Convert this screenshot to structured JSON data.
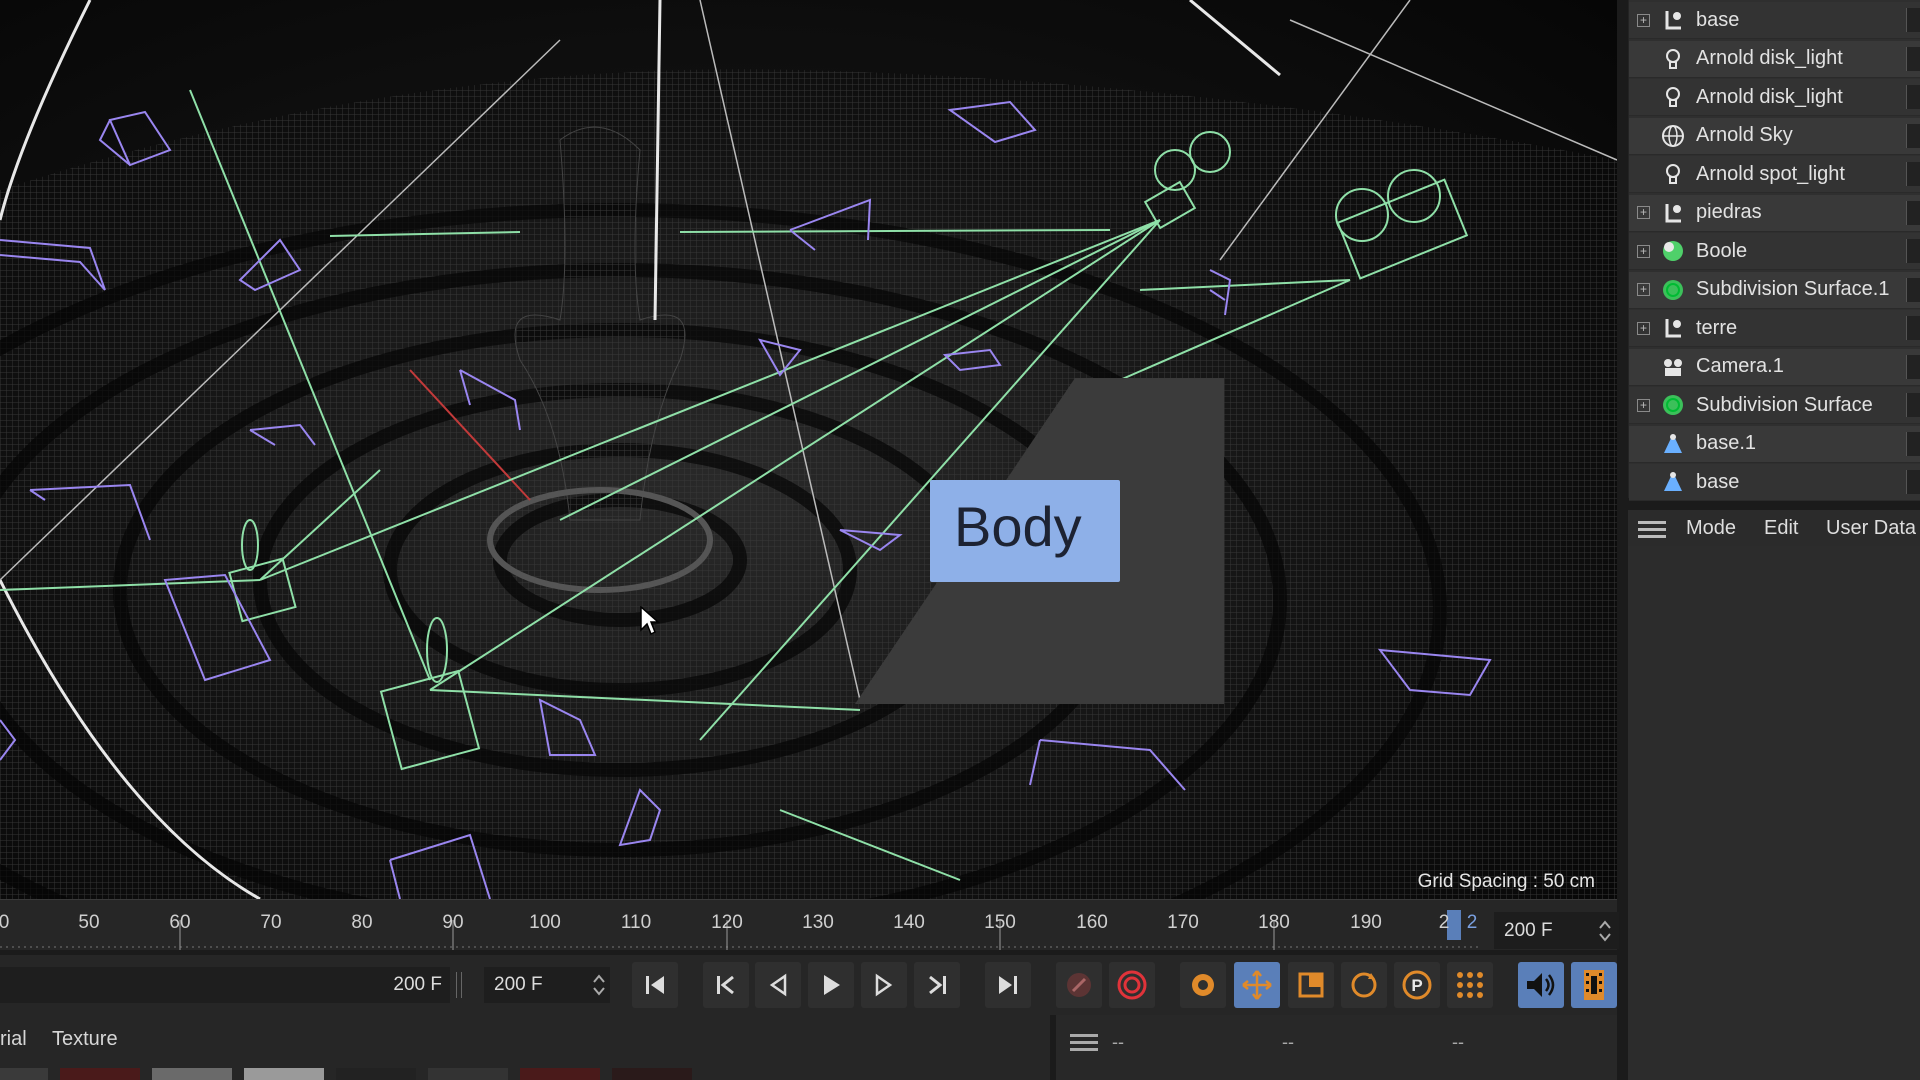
{
  "viewport": {
    "grid_spacing": "Grid Spacing : 50 cm",
    "tooltip_text": "Body"
  },
  "object_manager": {
    "items": [
      {
        "label": "base",
        "icon": "null-object-icon",
        "expandable": true
      },
      {
        "label": "Arnold disk_light",
        "icon": "light-bulb-icon",
        "expandable": false
      },
      {
        "label": "Arnold disk_light",
        "icon": "light-bulb-icon",
        "expandable": false
      },
      {
        "label": "Arnold Sky",
        "icon": "sky-globe-icon",
        "expandable": false
      },
      {
        "label": "Arnold spot_light",
        "icon": "light-bulb-icon",
        "expandable": false
      },
      {
        "label": "piedras",
        "icon": "null-object-icon",
        "expandable": true
      },
      {
        "label": "Boole",
        "icon": "boole-icon",
        "expandable": true
      },
      {
        "label": "Subdivision Surface.1",
        "icon": "subdivision-surface-icon",
        "expandable": true
      },
      {
        "label": "terre",
        "icon": "null-object-icon",
        "expandable": true
      },
      {
        "label": "Camera.1",
        "icon": "camera-icon",
        "expandable": false
      },
      {
        "label": "Subdivision Surface",
        "icon": "subdivision-surface-icon",
        "expandable": true
      },
      {
        "label": "base.1",
        "icon": "polygon-object-icon",
        "expandable": false
      },
      {
        "label": "base",
        "icon": "polygon-object-icon",
        "expandable": false
      }
    ]
  },
  "attributes": {
    "menu": [
      "Mode",
      "Edit",
      "User Data"
    ]
  },
  "timeline": {
    "ticks": [
      "0",
      "50",
      "60",
      "70",
      "80",
      "90",
      "100",
      "110",
      "120",
      "130",
      "140",
      "150",
      "160",
      "170",
      "180",
      "190",
      "2",
      "2"
    ],
    "end_frame": "200 F"
  },
  "transport": {
    "max_frame": "200 F",
    "preview_end": "200 F"
  },
  "bottom": {
    "tabs": [
      "rial",
      "Texture"
    ],
    "coords": [
      "--",
      "--",
      "--"
    ]
  },
  "colors": {
    "accent_blue": "#5a7fb9",
    "camera_green": "#8fe0a8",
    "wire_purple": "#9a86f0",
    "record_red": "#e0333a",
    "key_orange": "#e08a2a"
  }
}
